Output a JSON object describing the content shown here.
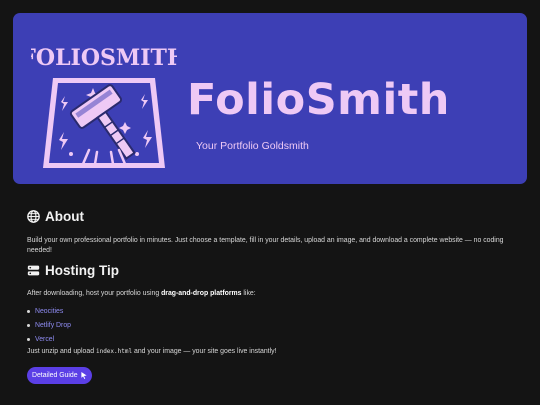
{
  "hero": {
    "logo_text": "FOLIOSMITH",
    "title": "FolioSmith",
    "subtitle": "Your Portfolio Goldsmith"
  },
  "about": {
    "icon": "globe-icon",
    "heading": "About",
    "body": "Build your own professional portfolio in minutes. Just choose a template, fill in your details, upload an image, and download a complete website — no coding needed!"
  },
  "hosting": {
    "icon": "server-icon",
    "heading": "Hosting Tip",
    "intro_before": "After downloading, host your portfolio using ",
    "intro_bold": "drag-and-drop platforms",
    "intro_after": " like:",
    "platforms": [
      "Neocities",
      "Netlify Drop",
      "Vercel"
    ],
    "note_before": "Just unzip and upload ",
    "note_code": "index.html",
    "note_after": " and your image — your site goes live instantly!",
    "button_label": "Detailed Guide"
  },
  "colors": {
    "hero_bg": "#3d3fb5",
    "hero_text": "#eec9f5",
    "page_bg": "#141414",
    "link": "#8f8cf2",
    "button_bg": "#5b3fe6"
  }
}
